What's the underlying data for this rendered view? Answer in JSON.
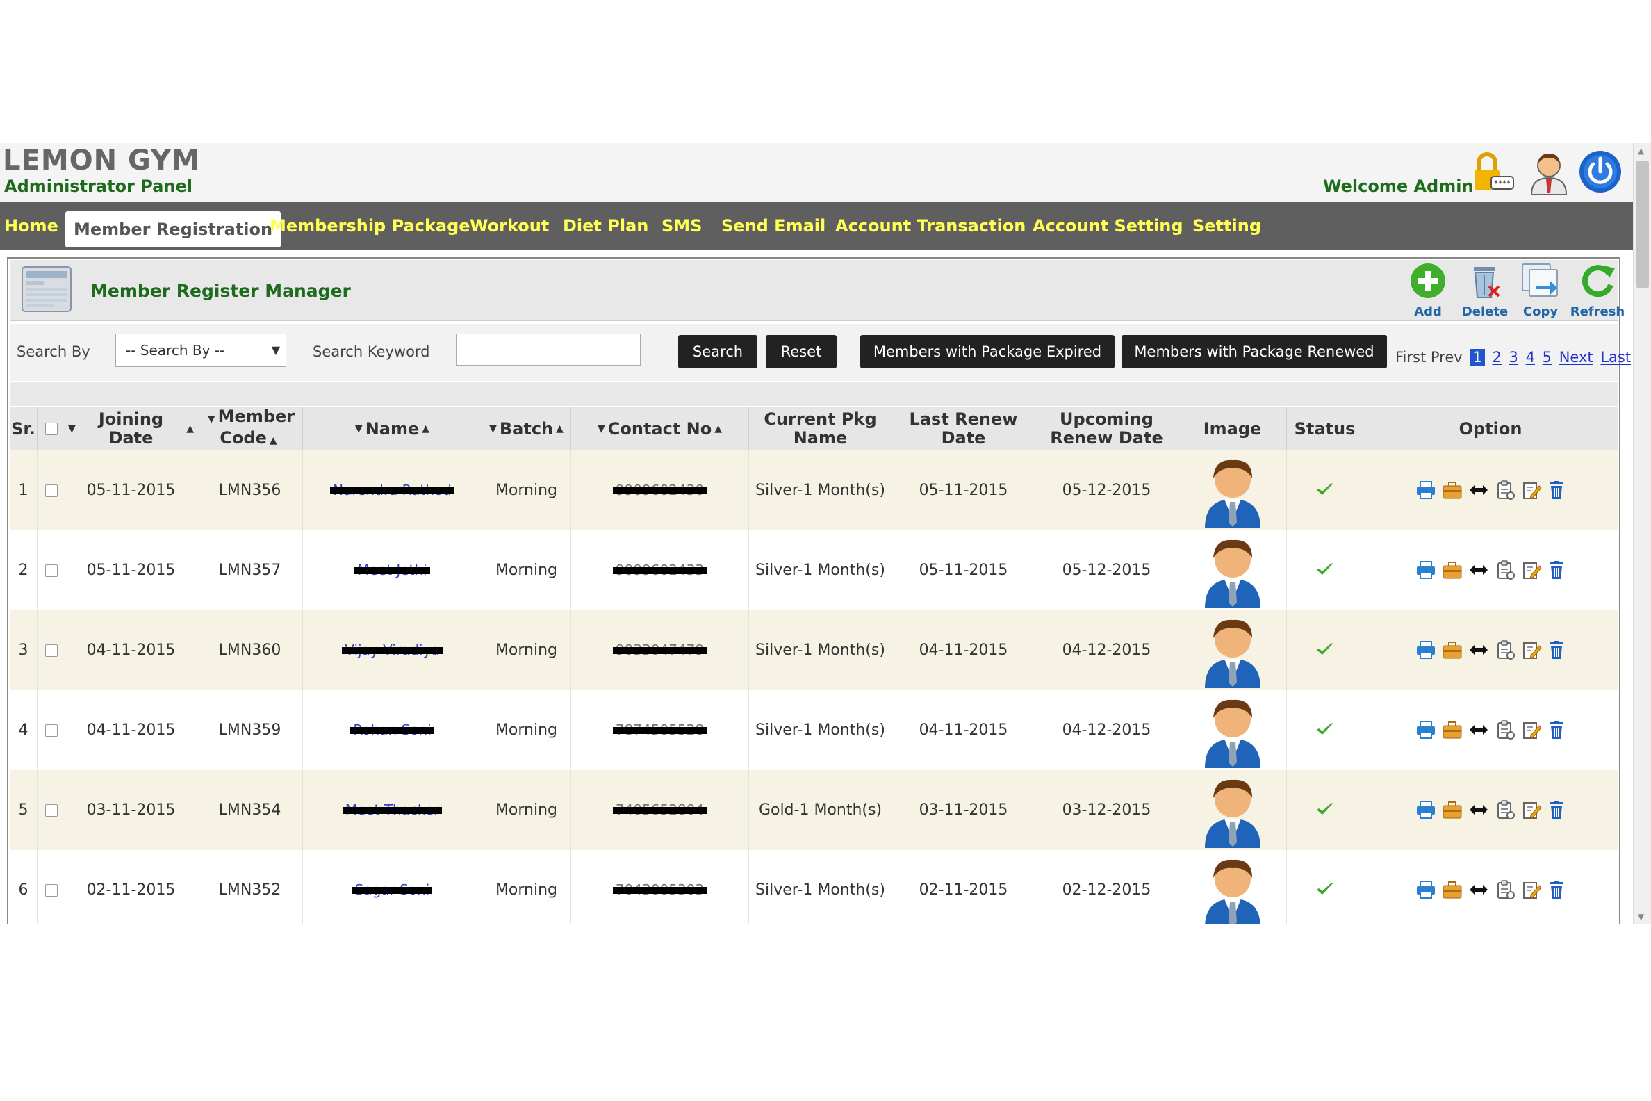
{
  "app": {
    "title": "LEMON GYM",
    "subtitle": "Administrator Panel",
    "welcome": "Welcome Admin"
  },
  "nav": {
    "home": "Home",
    "member_registration": "Member Registration",
    "membership_package": "Membership Package",
    "workout": "Workout",
    "diet_plan": "Diet Plan",
    "sms": "SMS",
    "send_email": "Send Email",
    "account_transaction": "Account Transaction",
    "account_setting": "Account Setting",
    "setting": "Setting"
  },
  "panel": {
    "title": "Member Register Manager",
    "tools": {
      "add": "Add",
      "delete": "Delete",
      "copy": "Copy",
      "refresh": "Refresh"
    }
  },
  "search": {
    "by_label": "Search By",
    "by_value": "-- Search By --",
    "keyword_label": "Search Keyword",
    "keyword_value": "",
    "search_btn": "Search",
    "reset_btn": "Reset",
    "expired_btn": "Members with Package Expired",
    "renewed_btn": "Members with Package Renewed"
  },
  "pager": {
    "first": "First",
    "prev": "Prev",
    "pages": [
      "1",
      "2",
      "3",
      "4",
      "5"
    ],
    "current": "1",
    "next": "Next",
    "last": "Last"
  },
  "table": {
    "headers": {
      "sr": "Sr.",
      "joining_date": "Joining Date",
      "member_code_1": "Member",
      "member_code_2": "Code",
      "name": "Name",
      "batch": "Batch",
      "contact": "Contact No",
      "pkg_1": "Current Pkg",
      "pkg_2": "Name",
      "last_renew_1": "Last Renew",
      "last_renew_2": "Date",
      "upcoming_1": "Upcoming",
      "upcoming_2": "Renew Date",
      "image": "Image",
      "status": "Status",
      "option": "Option"
    },
    "rows": [
      {
        "sr": "1",
        "joining": "05-11-2015",
        "code": "LMN356",
        "name": "Narendra Rathod",
        "batch": "Morning",
        "contact": "9909602430",
        "pkg": "Silver-1 Month(s)",
        "last_renew": "05-11-2015",
        "upcoming": "05-12-2015"
      },
      {
        "sr": "2",
        "joining": "05-11-2015",
        "code": "LMN357",
        "name": "Meet Jethi",
        "batch": "Morning",
        "contact": "9099602433",
        "pkg": "Silver-1 Month(s)",
        "last_renew": "05-11-2015",
        "upcoming": "05-12-2015"
      },
      {
        "sr": "3",
        "joining": "04-11-2015",
        "code": "LMN360",
        "name": "Vijay Viradiya",
        "batch": "Morning",
        "contact": "9033047479",
        "pkg": "Silver-1 Month(s)",
        "last_renew": "04-11-2015",
        "upcoming": "04-12-2015"
      },
      {
        "sr": "4",
        "joining": "04-11-2015",
        "code": "LMN359",
        "name": "Rohan Soni",
        "batch": "Morning",
        "contact": "7874505528",
        "pkg": "Silver-1 Month(s)",
        "last_renew": "04-11-2015",
        "upcoming": "04-12-2015"
      },
      {
        "sr": "5",
        "joining": "03-11-2015",
        "code": "LMN354",
        "name": "Meet Thacker",
        "batch": "Morning",
        "contact": "7405652804",
        "pkg": "Gold-1 Month(s)",
        "last_renew": "03-11-2015",
        "upcoming": "03-12-2015"
      },
      {
        "sr": "6",
        "joining": "02-11-2015",
        "code": "LMN352",
        "name": "Sagar Soni",
        "batch": "Morning",
        "contact": "7043005303",
        "pkg": "Silver-1 Month(s)",
        "last_renew": "02-11-2015",
        "upcoming": "02-12-2015"
      }
    ]
  },
  "colors": {
    "nav_bg": "#5f5f5f",
    "nav_text": "#ffff55",
    "brand_green": "#1e6b1e",
    "row_tint": "#f6f3e4",
    "link_blue": "#3344cc"
  }
}
